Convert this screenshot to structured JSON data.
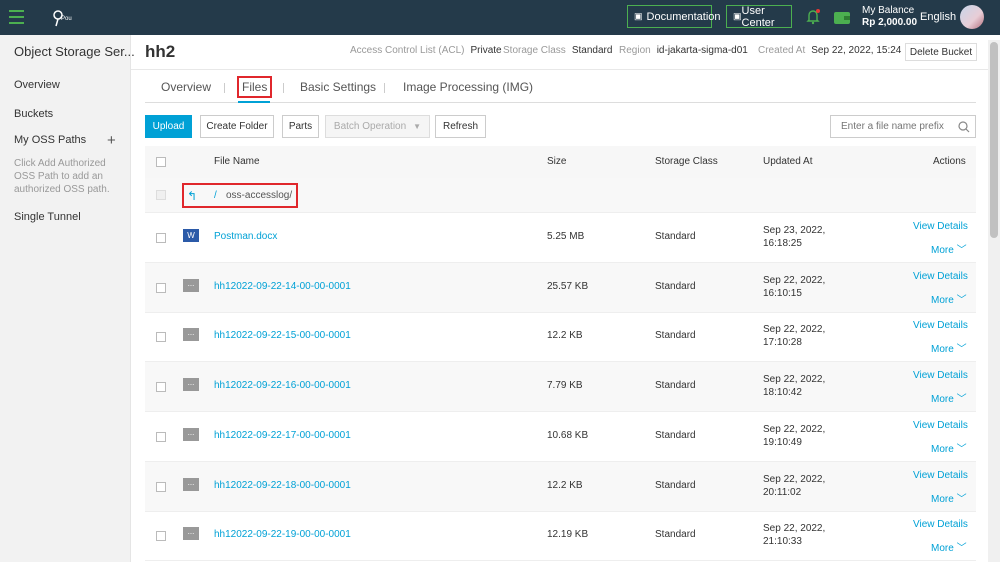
{
  "sidebar": {
    "title": "Object Storage Ser...",
    "items": [
      {
        "label": "Overview"
      },
      {
        "label": "Buckets"
      },
      {
        "label": "My OSS Paths"
      },
      {
        "label": "Single Tunnel"
      }
    ],
    "hint": "Click Add Authorized OSS Path to add an authorized OSS path."
  },
  "topbar": {
    "logo_text": "Pou",
    "documentation": "Documentation",
    "user_center": "User Center",
    "balance_label": "My Balance",
    "balance_value": "Rp 2,000.00",
    "language": "English"
  },
  "bucket": {
    "name": "hh2",
    "acl_label": "Access Control List (ACL)",
    "acl_value": "Private",
    "storage_label": "Storage Class",
    "storage_value": "Standard",
    "region_label": "Region",
    "region_value": "id-jakarta-sigma-d01",
    "created_label": "Created At",
    "created_value": "Sep 22, 2022, 15:24",
    "delete_label": "Delete Bucket"
  },
  "tabs": [
    {
      "label": "Overview"
    },
    {
      "label": "Files"
    },
    {
      "label": "Basic Settings"
    },
    {
      "label": "Image Processing (IMG)"
    }
  ],
  "toolbar": {
    "upload": "Upload",
    "create_folder": "Create Folder",
    "parts": "Parts",
    "batch": "Batch Operation",
    "refresh": "Refresh",
    "search_placeholder": "Enter a file name prefix"
  },
  "table": {
    "headers": {
      "name": "File Name",
      "size": "Size",
      "class": "Storage Class",
      "updated": "Updated At",
      "actions": "Actions"
    },
    "back_path": "oss-accesslog/",
    "back_slash": "/",
    "view_details": "View Details",
    "more": "More",
    "rows": [
      {
        "name": "Postman.docx",
        "icon": "word-doc-icon",
        "icon_text": "W",
        "size": "5.25 MB",
        "class": "Standard",
        "date": "Sep 23, 2022,",
        "time": "16:18:25"
      },
      {
        "name": "hh12022-09-22-14-00-00-0001",
        "icon": "file-icon",
        "icon_text": "...",
        "size": "25.57 KB",
        "class": "Standard",
        "date": "Sep 22, 2022,",
        "time": "16:10:15"
      },
      {
        "name": "hh12022-09-22-15-00-00-0001",
        "icon": "file-icon",
        "icon_text": "...",
        "size": "12.2 KB",
        "class": "Standard",
        "date": "Sep 22, 2022,",
        "time": "17:10:28"
      },
      {
        "name": "hh12022-09-22-16-00-00-0001",
        "icon": "file-icon",
        "icon_text": "...",
        "size": "7.79 KB",
        "class": "Standard",
        "date": "Sep 22, 2022,",
        "time": "18:10:42"
      },
      {
        "name": "hh12022-09-22-17-00-00-0001",
        "icon": "file-icon",
        "icon_text": "...",
        "size": "10.68 KB",
        "class": "Standard",
        "date": "Sep 22, 2022,",
        "time": "19:10:49"
      },
      {
        "name": "hh12022-09-22-18-00-00-0001",
        "icon": "file-icon",
        "icon_text": "...",
        "size": "12.2 KB",
        "class": "Standard",
        "date": "Sep 22, 2022,",
        "time": "20:11:02"
      },
      {
        "name": "hh12022-09-22-19-00-00-0001",
        "icon": "file-icon",
        "icon_text": "...",
        "size": "12.19 KB",
        "class": "Standard",
        "date": "Sep 22, 2022,",
        "time": "21:10:33"
      }
    ]
  },
  "colors": {
    "topbar": "#243a4a",
    "accent": "#00a1d6",
    "highlight": "#e0272c",
    "green": "#4caf50"
  }
}
